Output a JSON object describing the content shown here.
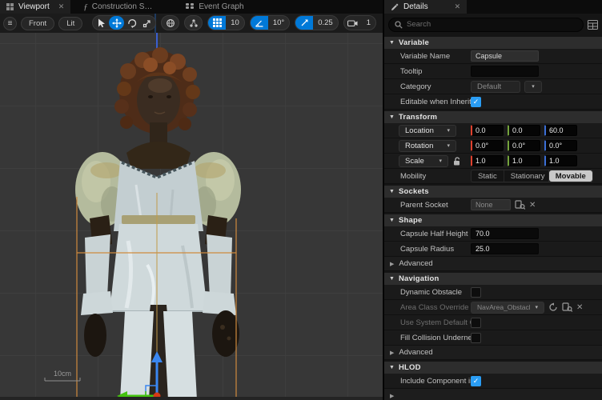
{
  "icons": {
    "close": "✕",
    "check": "✓",
    "chevron": "▾",
    "hamburger": "≡",
    "collapse": "▼",
    "expand": "▶",
    "fx": "ƒ",
    "clear": "✕"
  },
  "colors": {
    "accent_blue": "#0079d8",
    "checkbox_blue": "#2a9df4",
    "axis_x_red": "#e0412e",
    "axis_y_green": "#74a33c",
    "axis_z_blue": "#3b6fd6",
    "selection_outline_orange": "#cf8a3e",
    "mobility_selected_bg": "#c9c9c9"
  },
  "panel_tabs": {
    "viewport": "Viewport",
    "construction_script": "Construction S…",
    "event_graph": "Event Graph",
    "details": "Details"
  },
  "viewport": {
    "view_mode_button": "Front",
    "lit_button": "Lit",
    "toolbar": {
      "grid_snap_value": "10",
      "rotation_snap_value": "10°",
      "scale_snap_value": "0.25",
      "camera_speed_value": "1"
    },
    "scale_ruler_label": "10cm"
  },
  "details": {
    "search_placeholder": "Search",
    "variable": {
      "title": "Variable",
      "variable_name": {
        "label": "Variable Name",
        "value": "Capsule"
      },
      "tooltip": {
        "label": "Tooltip",
        "value": ""
      },
      "category": {
        "label": "Category",
        "value": "Default"
      },
      "editable": {
        "label": "Editable when Inherited"
      }
    },
    "transform": {
      "title": "Transform",
      "location": {
        "label": "Location",
        "x": "0.0",
        "y": "0.0",
        "z": "60.0"
      },
      "rotation": {
        "label": "Rotation",
        "x": "0.0°",
        "y": "0.0°",
        "z": "0.0°"
      },
      "scale": {
        "label": "Scale",
        "x": "1.0",
        "y": "1.0",
        "z": "1.0"
      },
      "mobility": {
        "label": "Mobility",
        "options": [
          "Static",
          "Stationary",
          "Movable"
        ],
        "selected": "Movable"
      }
    },
    "sockets": {
      "title": "Sockets",
      "parent_socket": {
        "label": "Parent Socket",
        "value": "None"
      }
    },
    "shape": {
      "title": "Shape",
      "half_height": {
        "label": "Capsule Half Height",
        "value": "70.0"
      },
      "radius": {
        "label": "Capsule Radius",
        "value": "25.0"
      },
      "advanced_label": "Advanced"
    },
    "navigation": {
      "title": "Navigation",
      "dynamic_obstacle_label": "Dynamic Obstacle",
      "area_class": {
        "label": "Area Class Override",
        "value": "NavArea_Obstacle"
      },
      "use_system_label": "Use System Default Obstacl…",
      "fill_collision_label": "Fill Collision Underneath for…",
      "advanced_label": "Advanced"
    },
    "hlod": {
      "title": "HLOD",
      "include": {
        "label": "Include Component in HLOD"
      }
    }
  }
}
